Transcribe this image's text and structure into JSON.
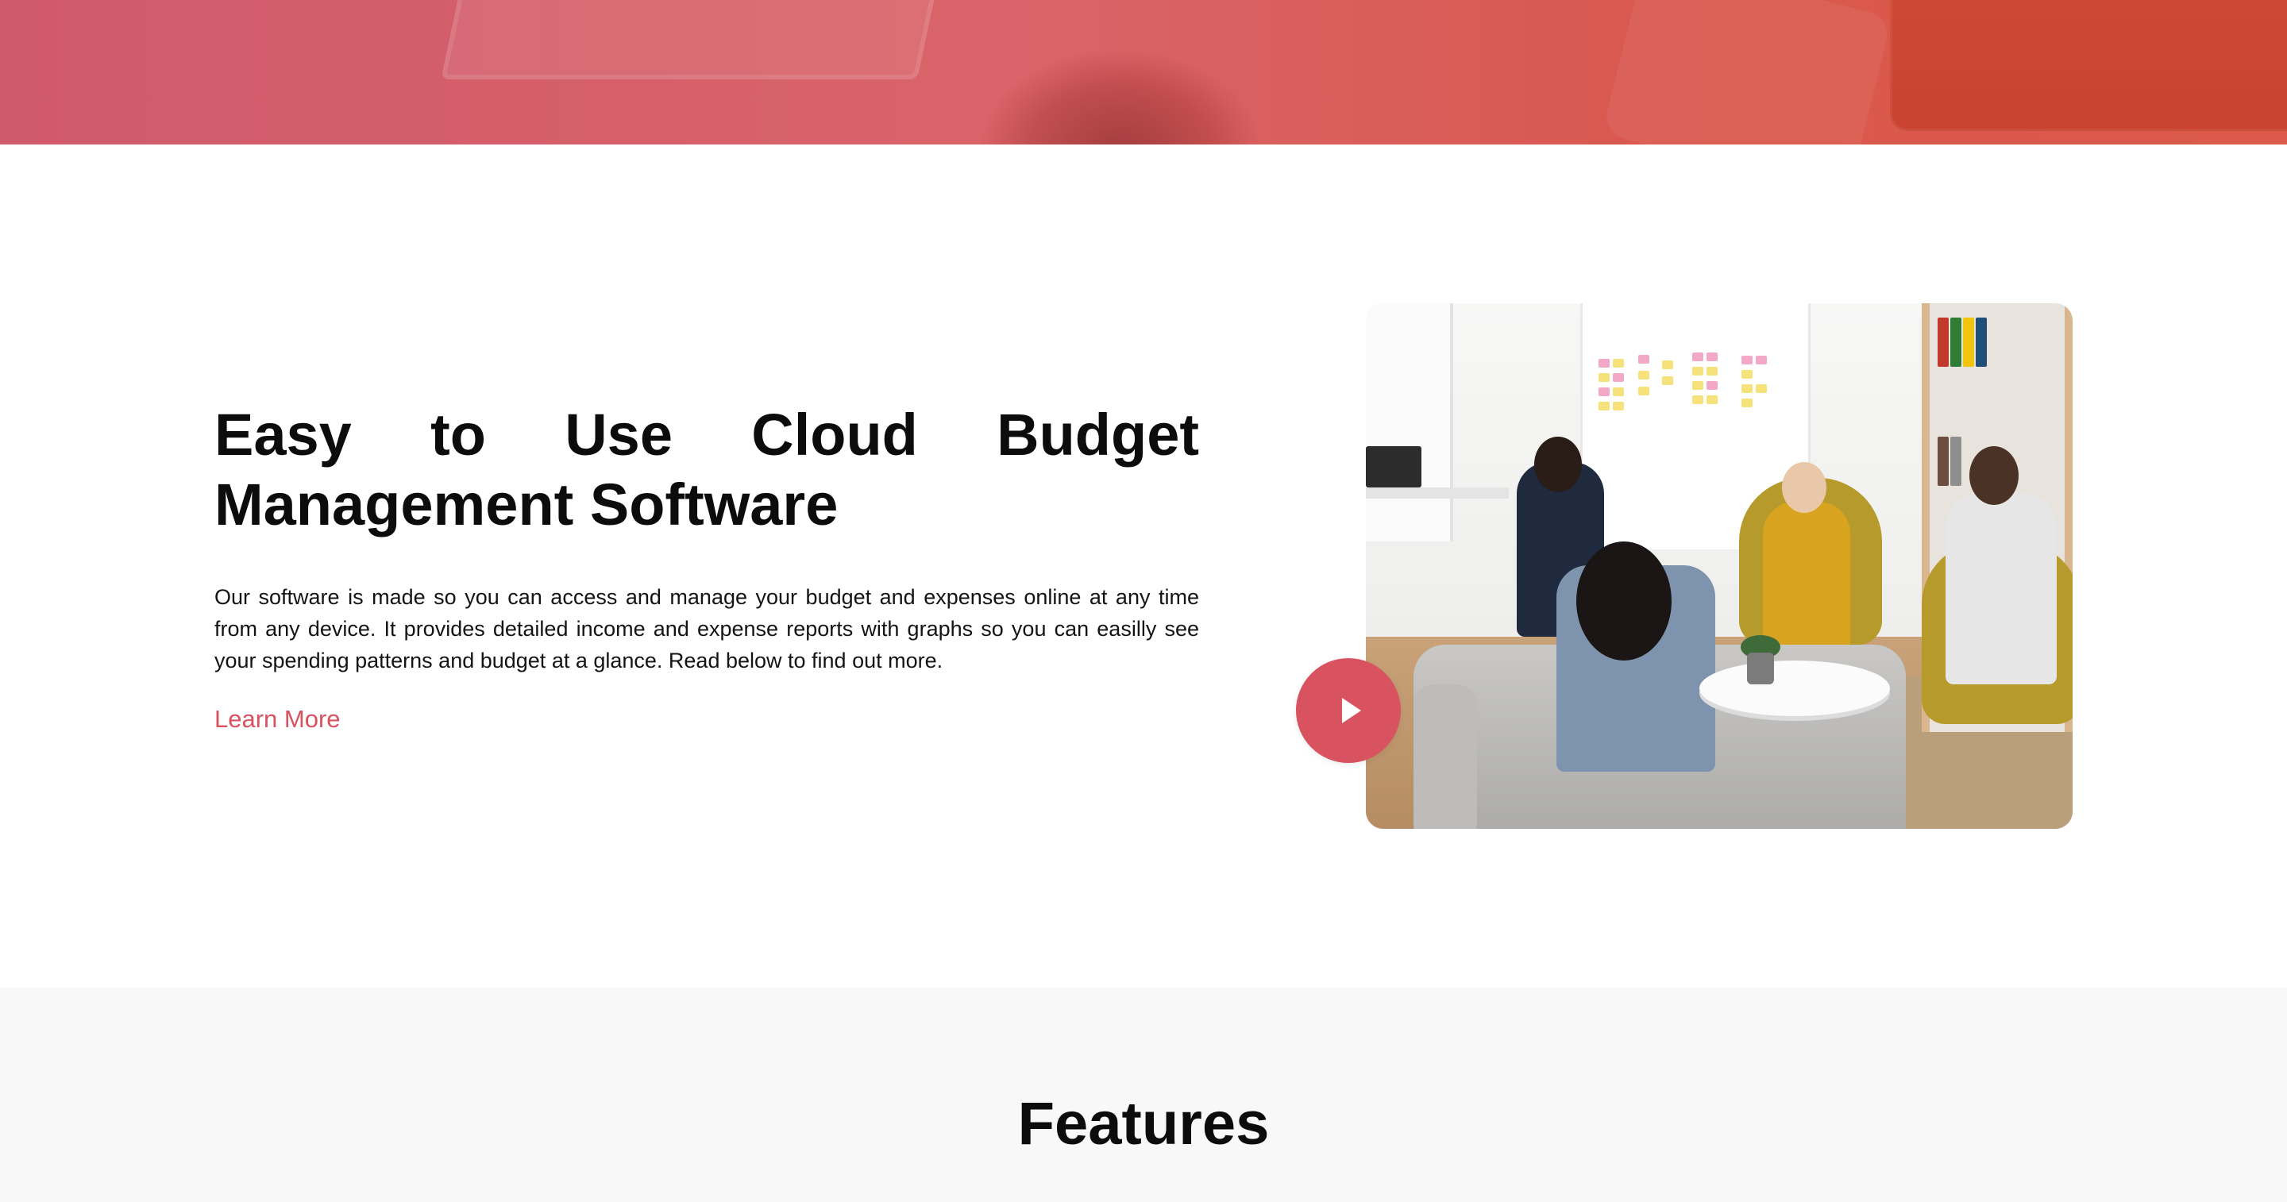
{
  "hero": {
    "image": "hero-photo-overlay",
    "overlay_colors": [
      "#cf5a6c",
      "#db5a4a"
    ]
  },
  "intro": {
    "title_line1": "Easy to Use Cloud Budget",
    "title_line2": "Management Software",
    "body": "Our software is made so you can access and manage your budget and expenses online at any time from any device. It provides detailed income and expense reports with graphs so you can easilly see your spending patterns and budget at a glance. Read below to find out more.",
    "learn_more": "Learn More"
  },
  "video": {
    "thumbnail": "team-meeting-photo",
    "play_icon": "play-icon",
    "accent_color": "#d8525f"
  },
  "features": {
    "title": "Features"
  },
  "colors": {
    "accent": "#d8525f",
    "text": "#0c0c0c",
    "features_bg": "#f8f8f8"
  }
}
